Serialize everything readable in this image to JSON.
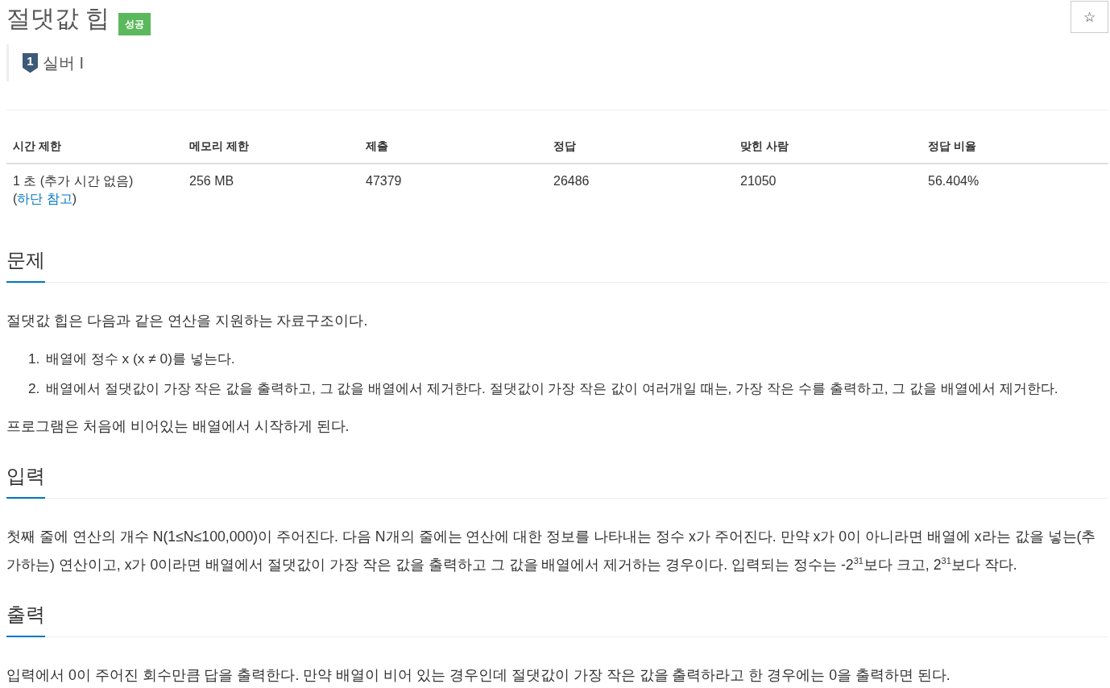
{
  "header": {
    "title": "절댓값 힙",
    "result_badge": "성공",
    "favorite_button": "☆"
  },
  "tier": {
    "rank": "1",
    "name": "실버 I"
  },
  "info_table": {
    "columns": [
      "시간 제한",
      "메모리 제한",
      "제출",
      "정답",
      "맞힌 사람",
      "정답 비율"
    ],
    "rows": [
      [
        {
          "text": "1 초 (추가 시간 없음) (",
          "link": "하단 참고",
          "suffix": ")"
        },
        {
          "text": "256 MB"
        },
        {
          "text": "47379"
        },
        {
          "text": "26486"
        },
        {
          "text": "21050"
        },
        {
          "text": "56.404%"
        }
      ]
    ]
  },
  "sections": [
    {
      "heading": "문제",
      "blocks": [
        {
          "kind": "paragraph",
          "text": "절댓값 힙은 다음과 같은 연산을 지원하는 자료구조이다."
        },
        {
          "kind": "list",
          "items": [
            {
              "number": "1.",
              "text": "배열에 정수 x (x ≠ 0)를 넣는다."
            },
            {
              "number": "2.",
              "text": "배열에서 절댓값이 가장 작은 값을 출력하고, 그 값을 배열에서 제거한다. 절댓값이 가장 작은 값이 여러개일 때는, 가장 작은 수를 출력하고, 그 값을 배열에서 제거한다."
            }
          ]
        },
        {
          "kind": "paragraph",
          "text": "프로그램은 처음에 비어있는 배열에서 시작하게 된다."
        }
      ]
    },
    {
      "heading": "입력",
      "blocks": [
        {
          "kind": "paragraph",
          "text": "첫째 줄에 연산의 개수 N(1≤N≤100,000)이 주어진다. 다음 N개의 줄에는 연산에 대한 정보를 나타내는 정수 x가 주어진다. 만약 x가 0이 아니라면 배열에 x라는 값을 넣는(추가하는) 연산이고, x가 0이라면 배열에서 절댓값이 가장 작은 값을 출력하고 그 값을 배열에서 제거하는 경우이다. 입력되는 정수는 -2$^{31}$보다 크고, 2$^{31}$보다 작다."
        }
      ]
    },
    {
      "heading": "출력",
      "blocks": [
        {
          "kind": "paragraph",
          "text": "입력에서 0이 주어진 회수만큼 답을 출력한다. 만약 배열이 비어 있는 경우인데 절댓값이 가장 작은 값을 출력하라고 한 경우에는 0을 출력하면 된다."
        }
      ]
    }
  ]
}
